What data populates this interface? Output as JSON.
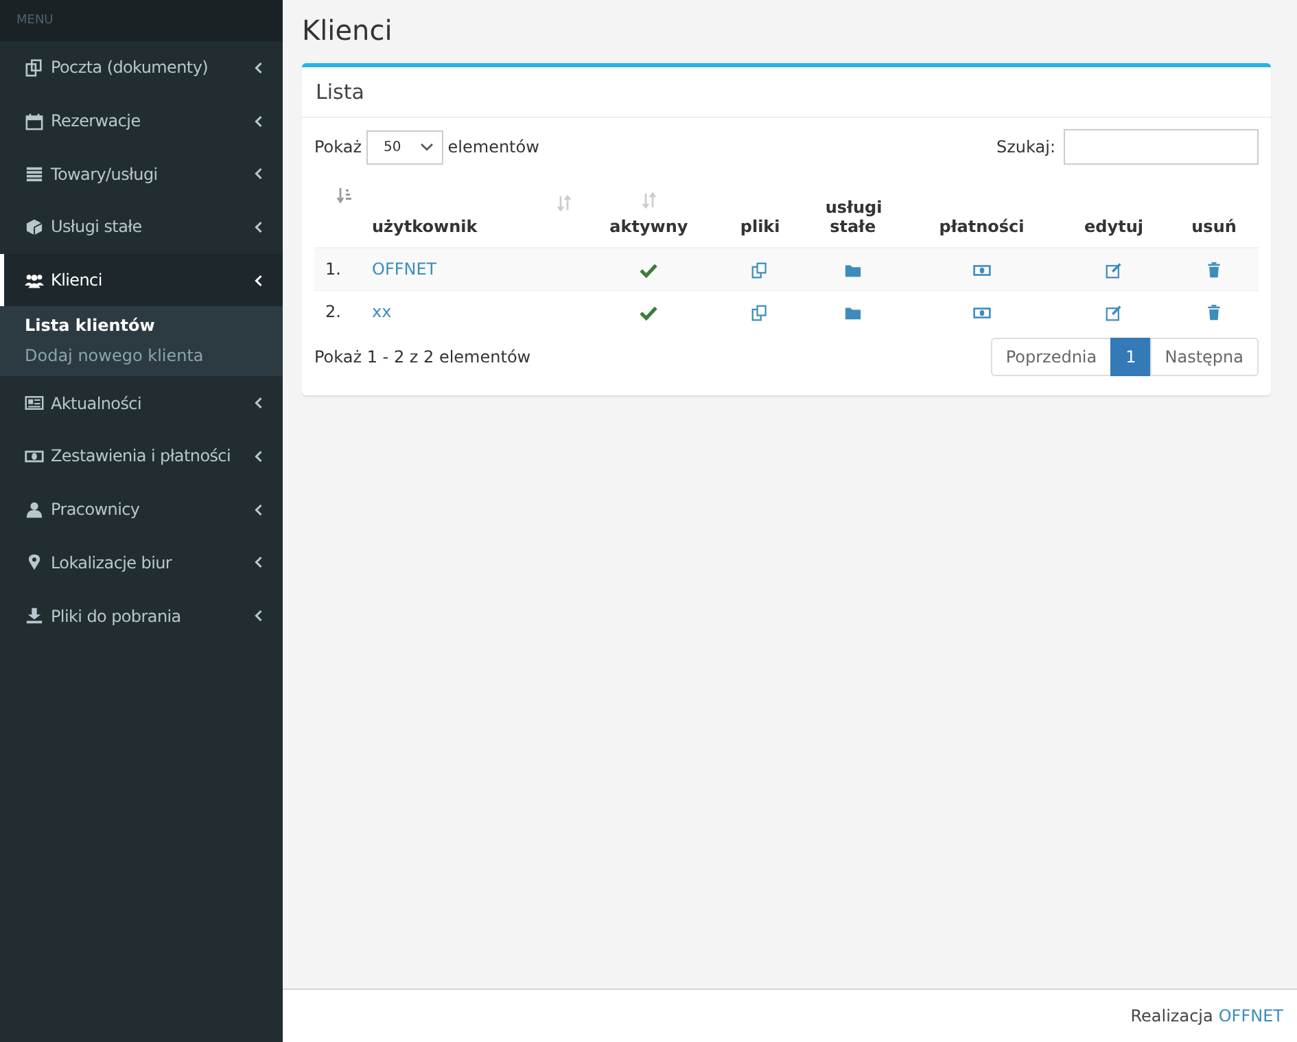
{
  "sidebar": {
    "header": "MENU",
    "items": [
      {
        "label": "Poczta (dokumenty)",
        "selected": false
      },
      {
        "label": "Rezerwacje",
        "selected": false
      },
      {
        "label": "Towary/usługi",
        "selected": false
      },
      {
        "label": "Usługi stałe",
        "selected": false
      },
      {
        "label": "Klienci",
        "selected": true,
        "children": [
          {
            "label": "Lista klientów",
            "selected": true
          },
          {
            "label": "Dodaj nowego klienta",
            "selected": false
          }
        ]
      },
      {
        "label": "Aktualności",
        "selected": false
      },
      {
        "label": "Zestawienia i płatności",
        "selected": false
      },
      {
        "label": "Pracownicy",
        "selected": false
      },
      {
        "label": "Lokalizacje biur",
        "selected": false
      },
      {
        "label": "Pliki do pobrania",
        "selected": false
      }
    ]
  },
  "page_title": "Klienci",
  "panel": {
    "title": "Lista",
    "length": {
      "label_before": "Pokaż",
      "value": "50",
      "label_after": "elementów"
    },
    "search": {
      "label": "Szukaj:"
    },
    "table": {
      "columns": [
        {
          "kind": "sorted"
        },
        {
          "label": "użytkownik",
          "kind": "sortable"
        },
        {
          "label": "aktywny",
          "kind": "sortable"
        },
        {
          "label": "pliki",
          "kind": "plain"
        },
        {
          "label": "usługi stałe",
          "kind": "plain"
        },
        {
          "label": "płatności",
          "kind": "plain"
        },
        {
          "label": "edytuj",
          "kind": "plain"
        },
        {
          "label": "usuń",
          "kind": "plain"
        }
      ],
      "rows": [
        {
          "number": "1.",
          "name": "OFFNET",
          "active": true
        },
        {
          "number": "2.",
          "name": "xx",
          "active": true
        }
      ]
    },
    "info": "Pokaż 1 - 2 z 2 elementów",
    "pagination": {
      "previous": "Poprzednia",
      "pages": [
        {
          "label": "1",
          "selected": true
        }
      ],
      "next": "Następna"
    }
  },
  "footer": {
    "text": "Realizacja",
    "link": "OFFNET"
  }
}
